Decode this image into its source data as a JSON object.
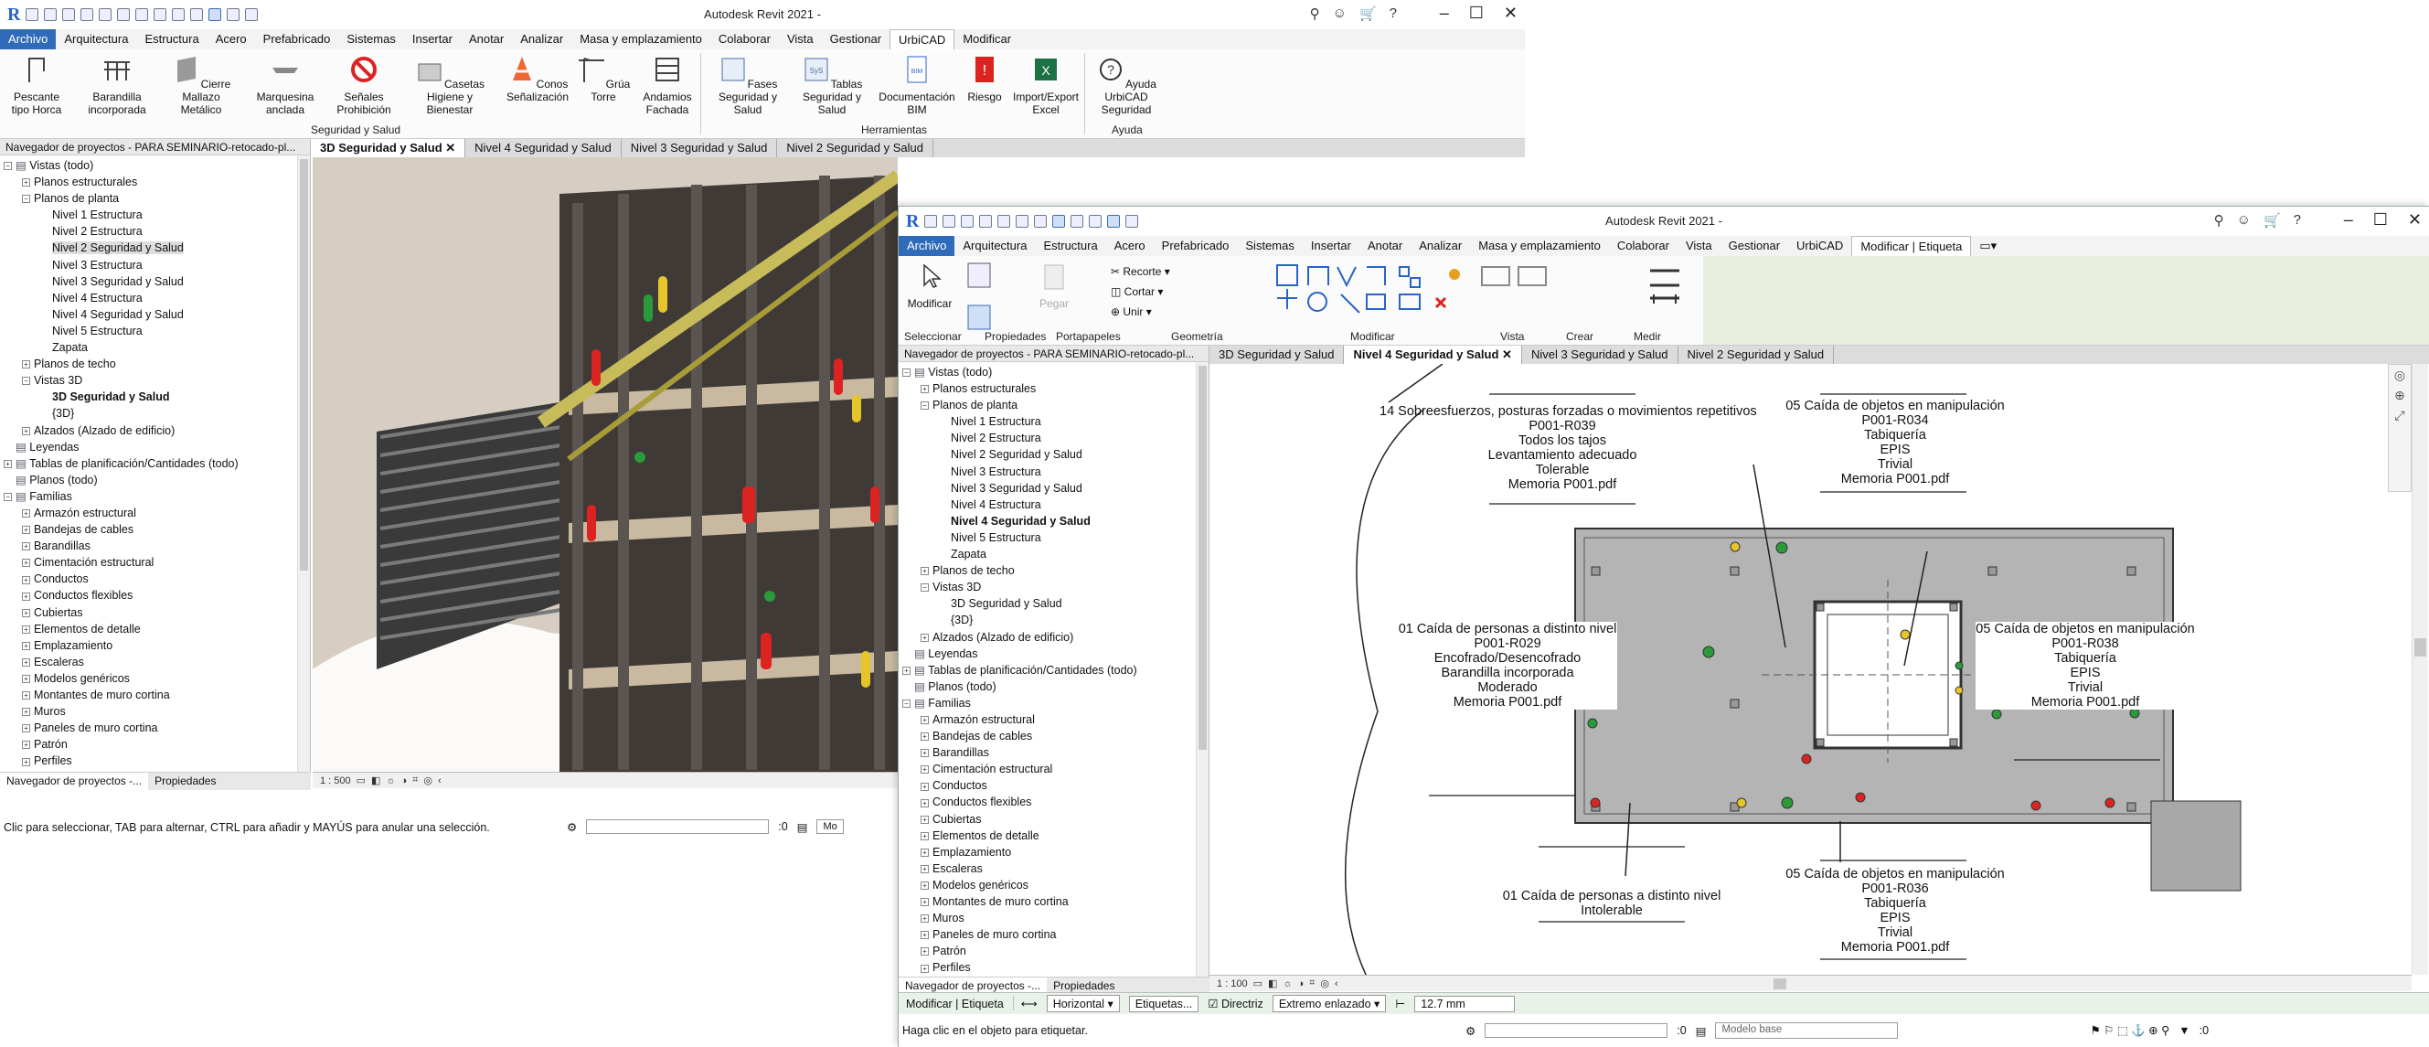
{
  "back": {
    "title": "Autodesk Revit 2021 -",
    "menu": [
      "Archivo",
      "Arquitectura",
      "Estructura",
      "Acero",
      "Prefabricado",
      "Sistemas",
      "Insertar",
      "Anotar",
      "Analizar",
      "Masa y emplazamiento",
      "Colaborar",
      "Vista",
      "Gestionar",
      "UrbiCAD",
      "Modificar"
    ],
    "ribbon": [
      "Pescante tipo Horca",
      "Barandilla incorporada",
      "Cierre Mallazo Metálico",
      "Marquesina anclada",
      "Señales Prohibición",
      "Casetas Higiene y Bienestar",
      "Conos Señalización",
      "Grúa Torre",
      "Andamios Fachada",
      "Fases Seguridad y Salud",
      "Tablas Seguridad y Salud",
      "Documentación BIM",
      "Riesgo",
      "Import/Export Excel",
      "Ayuda UrbiCAD Seguridad"
    ],
    "groups": [
      "Seguridad y Salud",
      "Herramientas",
      "Ayuda"
    ],
    "browser_title": "Navegador de proyectos - PARA SEMINARIO-retocado-pl...",
    "tree": [
      "Vistas (todo)",
      "Planos estructurales",
      "Planos de planta",
      "Nivel 1 Estructura",
      "Nivel 2 Estructura",
      "Nivel 2 Seguridad y Salud",
      "Nivel 3 Estructura",
      "Nivel 3 Seguridad y Salud",
      "Nivel 4 Estructura",
      "Nivel 4 Seguridad y Salud",
      "Nivel 5 Estructura",
      "Zapata",
      "Planos de techo",
      "Vistas 3D",
      "3D Seguridad y Salud",
      "{3D}",
      "Alzados (Alzado de edificio)",
      "Leyendas",
      "Tablas de planificación/Cantidades (todo)",
      "Planos (todo)",
      "Familias",
      "Armazón estructural",
      "Bandejas de cables",
      "Barandillas",
      "Cimentación estructural",
      "Conductos",
      "Conductos flexibles",
      "Cubiertas",
      "Elementos de detalle",
      "Emplazamiento",
      "Escaleras",
      "Modelos genéricos",
      "Montantes de muro cortina",
      "Muros",
      "Paneles de muro cortina",
      "Patrón",
      "Perfiles"
    ],
    "tabs": [
      "3D Seguridad y Salud",
      "Nivel 4 Seguridad y Salud",
      "Nivel 3 Seguridad y Salud",
      "Nivel 2 Seguridad y Salud"
    ],
    "ptabs": [
      "Navegador de proyectos -...",
      "Propiedades"
    ],
    "scale": "1 : 500",
    "status": "Clic para seleccionar, TAB para alternar, CTRL para añadir y MAYÚS para anular una selección.",
    "zero": ":0",
    "mod": "Mo"
  },
  "front": {
    "title": "Autodesk Revit 2021 -",
    "menu": [
      "Archivo",
      "Arquitectura",
      "Estructura",
      "Acero",
      "Prefabricado",
      "Sistemas",
      "Insertar",
      "Anotar",
      "Analizar",
      "Masa y emplazamiento",
      "Colaborar",
      "Vista",
      "Gestionar",
      "UrbiCAD",
      "Modificar | Etiqueta"
    ],
    "ribbon": {
      "modificar": "Modificar",
      "pegar": "Pegar",
      "recorte": "Recorte",
      "cortar": "Cortar",
      "unir": "Unir"
    },
    "groups": [
      "Seleccionar",
      "Propiedades",
      "Portapapeles",
      "Geometría",
      "Modificar",
      "Vista",
      "Crear",
      "Medir"
    ],
    "browser_title": "Navegador de proyectos - PARA SEMINARIO-retocado-pl...",
    "tree": [
      "Vistas (todo)",
      "Planos estructurales",
      "Planos de planta",
      "Nivel 1 Estructura",
      "Nivel 2 Estructura",
      "Nivel 2 Seguridad y Salud",
      "Nivel 3 Estructura",
      "Nivel 3 Seguridad y Salud",
      "Nivel 4 Estructura",
      "Nivel 4 Seguridad y Salud",
      "Nivel 5 Estructura",
      "Zapata",
      "Planos de techo",
      "Vistas 3D",
      "3D Seguridad y Salud",
      "{3D}",
      "Alzados (Alzado de edificio)",
      "Leyendas",
      "Tablas de planificación/Cantidades (todo)",
      "Planos (todo)",
      "Familias",
      "Armazón estructural",
      "Bandejas de cables",
      "Barandillas",
      "Cimentación estructural",
      "Conductos",
      "Conductos flexibles",
      "Cubiertas",
      "Elementos de detalle",
      "Emplazamiento",
      "Escaleras",
      "Modelos genéricos",
      "Montantes de muro cortina",
      "Muros",
      "Paneles de muro cortina",
      "Patrón",
      "Perfiles"
    ],
    "tabs": [
      "3D Seguridad y Salud",
      "Nivel 4 Seguridad y Salud",
      "Nivel 3 Seguridad y Salud",
      "Nivel 2 Seguridad y Salud"
    ],
    "ptabs": [
      "Navegador de proyectos -...",
      "Propiedades"
    ],
    "scale": "1 : 100",
    "options": {
      "context": "Modificar | Etiqueta",
      "orientation": "Horizontal",
      "tags_btn": "Etiquetas...",
      "leader": "Directriz",
      "end": "Extremo enlazado",
      "length": "12.7 mm"
    },
    "status": "Haga clic en el objeto para etiquetar.",
    "model": "Modelo base",
    "zero": ":0",
    "zero2": ":0",
    "annotations": [
      [
        "14 Sobreesfuerzos, posturas forzadas o movimientos repetitivos",
        "P001-R039",
        "Todos los tajos",
        "Levantamiento adecuado",
        "Tolerable",
        "Memoria P001.pdf"
      ],
      [
        "05 Caída de objetos en manipulación",
        "P001-R034",
        "Tabiquería",
        "EPIS",
        "Trivial",
        "Memoria P001.pdf"
      ],
      [
        "01 Caída de personas a distinto nivel",
        "P001-R029",
        "Encofrado/Desencofrado",
        "Barandilla incorporada",
        "Moderado",
        "Memoria P001.pdf"
      ],
      [
        "05 Caída de objetos en manipulación",
        "P001-R038",
        "Tabiquería",
        "EPIS",
        "Trivial",
        "Memoria P001.pdf"
      ],
      [
        "01 Caída de personas a distinto nivel",
        "Intolerable"
      ],
      [
        "05 Caída de objetos en manipulación",
        "P001-R036",
        "Tabiquería",
        "EPIS",
        "Trivial",
        "Memoria P001.pdf"
      ]
    ]
  }
}
